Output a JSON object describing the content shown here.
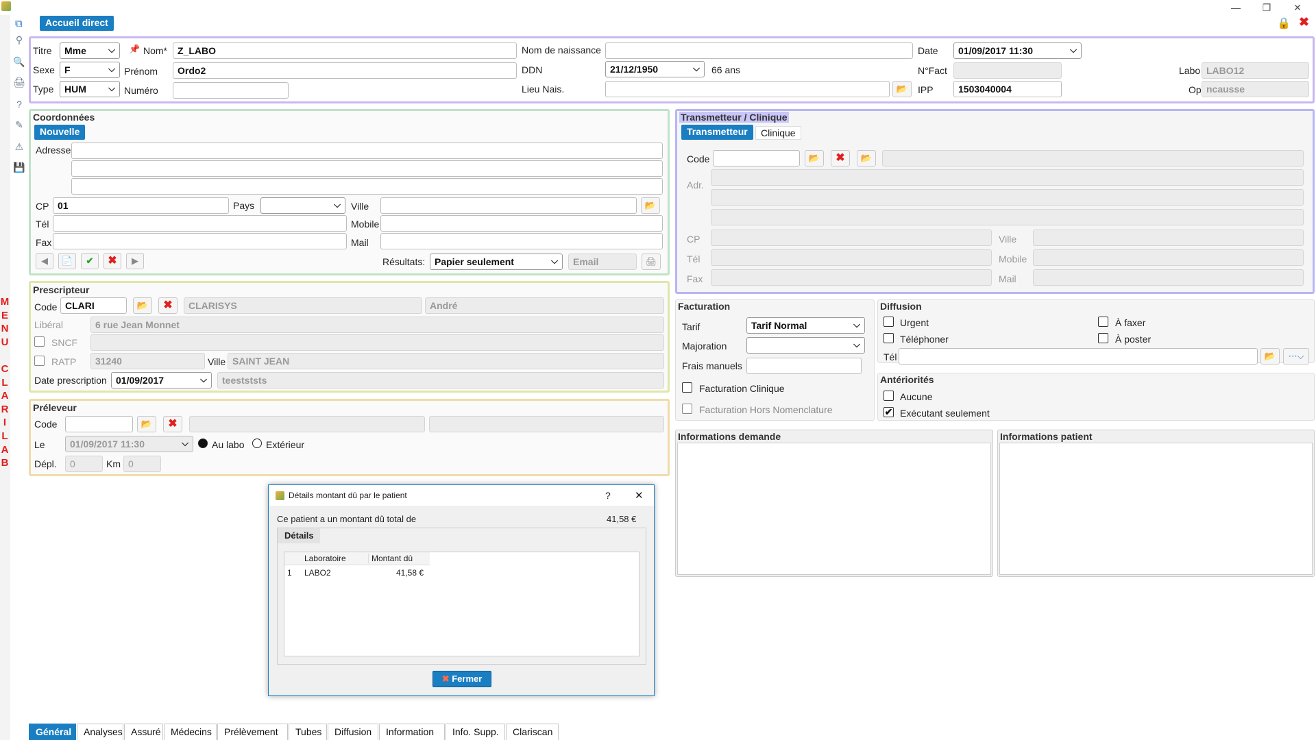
{
  "window": {
    "tab": "Accueil direct",
    "minimize": "—",
    "maximize": "❐",
    "close": "✕"
  },
  "side_menu": [
    "M",
    "E",
    "N",
    "U",
    "",
    "C",
    "L",
    "A",
    "R",
    "I",
    "L",
    "A",
    "B"
  ],
  "patient": {
    "titre_label": "Titre",
    "titre": "Mme",
    "nom_label": "Nom*",
    "nom": "Z_LABO",
    "naissance_label": "Nom de naissance",
    "naissance": "",
    "date_label": "Date",
    "date": "01/09/2017 11:30",
    "sexe_label": "Sexe",
    "sexe": "F",
    "prenom_label": "Prénom",
    "prenom": "Ordo2",
    "ddn_label": "DDN",
    "ddn": "21/12/1950",
    "age": "66 ans",
    "nfact_label": "N°Fact",
    "nfact": "",
    "labo_label": "Labo",
    "labo": "LABO12",
    "type_label": "Type",
    "type": "HUM",
    "numero_label": "Numéro",
    "numero": "",
    "lieu_label": "Lieu Nais.",
    "lieu": "",
    "ipp_label": "IPP",
    "ipp": "1503040004",
    "op_label": "Op",
    "op": "ncausse"
  },
  "coord": {
    "title": "Coordonnées",
    "new_btn": "Nouvelle",
    "adresse_label": "Adresse",
    "adresse": [
      "",
      "",
      ""
    ],
    "cp_label": "CP",
    "cp": "01",
    "pays_label": "Pays",
    "pays": "",
    "ville_label": "Ville",
    "ville": "",
    "tel_label": "Tél",
    "tel": "",
    "mobile_label": "Mobile",
    "mobile": "",
    "fax_label": "Fax",
    "fax": "",
    "mail_label": "Mail",
    "mail": "",
    "resultats_label": "Résultats:",
    "resultats": "Papier seulement",
    "email": "Email"
  },
  "transmetteur": {
    "title": "Transmetteur / Clinique",
    "tab1": "Transmetteur",
    "tab2": "Clinique",
    "code_label": "Code",
    "adr_label": "Adr.",
    "cp_label": "CP",
    "ville_label": "Ville",
    "tel_label": "Tél",
    "mobile_label": "Mobile",
    "fax_label": "Fax",
    "mail_label": "Mail"
  },
  "prescripteur": {
    "title": "Prescripteur",
    "code_label": "Code",
    "code": "CLARI",
    "nom": "CLARISYS",
    "prenom": "André",
    "liberal_label": "Libéral",
    "adresse": "6 rue Jean Monnet",
    "sncf_label": "SNCF",
    "ratp_label": "RATP",
    "cp": "31240",
    "ville_label": "Ville",
    "ville": "SAINT JEAN",
    "date_label": "Date prescription",
    "date": "01/09/2017",
    "note": "teestststs"
  },
  "preleveur": {
    "title": "Préleveur",
    "code_label": "Code",
    "le_label": "Le",
    "le": "01/09/2017 11:30",
    "au_labo": "Au labo",
    "exterieur": "Extérieur",
    "depl_label": "Dépl.",
    "depl": "0",
    "km_label": "Km",
    "km": "0"
  },
  "facturation": {
    "title": "Facturation",
    "tarif_label": "Tarif",
    "tarif": "Tarif Normal",
    "majoration_label": "Majoration",
    "majoration": "",
    "frais_label": "Frais manuels",
    "frais": "",
    "clinique_label": "Facturation Clinique",
    "hors_label": "Facturation Hors Nomenclature"
  },
  "diffusion": {
    "title": "Diffusion",
    "urgent": "Urgent",
    "faxer": "À faxer",
    "telephoner": "Téléphoner",
    "poster": "À poster",
    "tel_label": "Tél"
  },
  "anteriorites": {
    "title": "Antériorités",
    "aucune": "Aucune",
    "executant": "Exécutant seulement"
  },
  "info_demande": "Informations demande",
  "info_patient": "Informations patient",
  "tabs": [
    "Général",
    "Analyses",
    "Assuré",
    "Médecins",
    "Prélèvement",
    "Tubes",
    "Diffusion",
    "Information",
    "Info. Supp.",
    "Clariscan"
  ],
  "dialog": {
    "title": "Détails montant dû par le patient",
    "help": "?",
    "close": "✕",
    "summary": "Ce patient a un montant dû total de",
    "total": "41,58 €",
    "details_tab": "Détails",
    "columns": [
      "Laboratoire",
      "Montant dû"
    ],
    "rows": [
      {
        "num": "1",
        "labo": "LABO2",
        "montant": "41,58 €"
      }
    ],
    "fermer": "Fermer"
  },
  "colors": {
    "accent": "#1a7ec2",
    "patient_border": "#c9b8f0",
    "coord_border": "#bfe3c6",
    "trans_border": "#b7b6f5",
    "presc_border": "#dde8a8",
    "prel_border": "#f0dcaa"
  }
}
